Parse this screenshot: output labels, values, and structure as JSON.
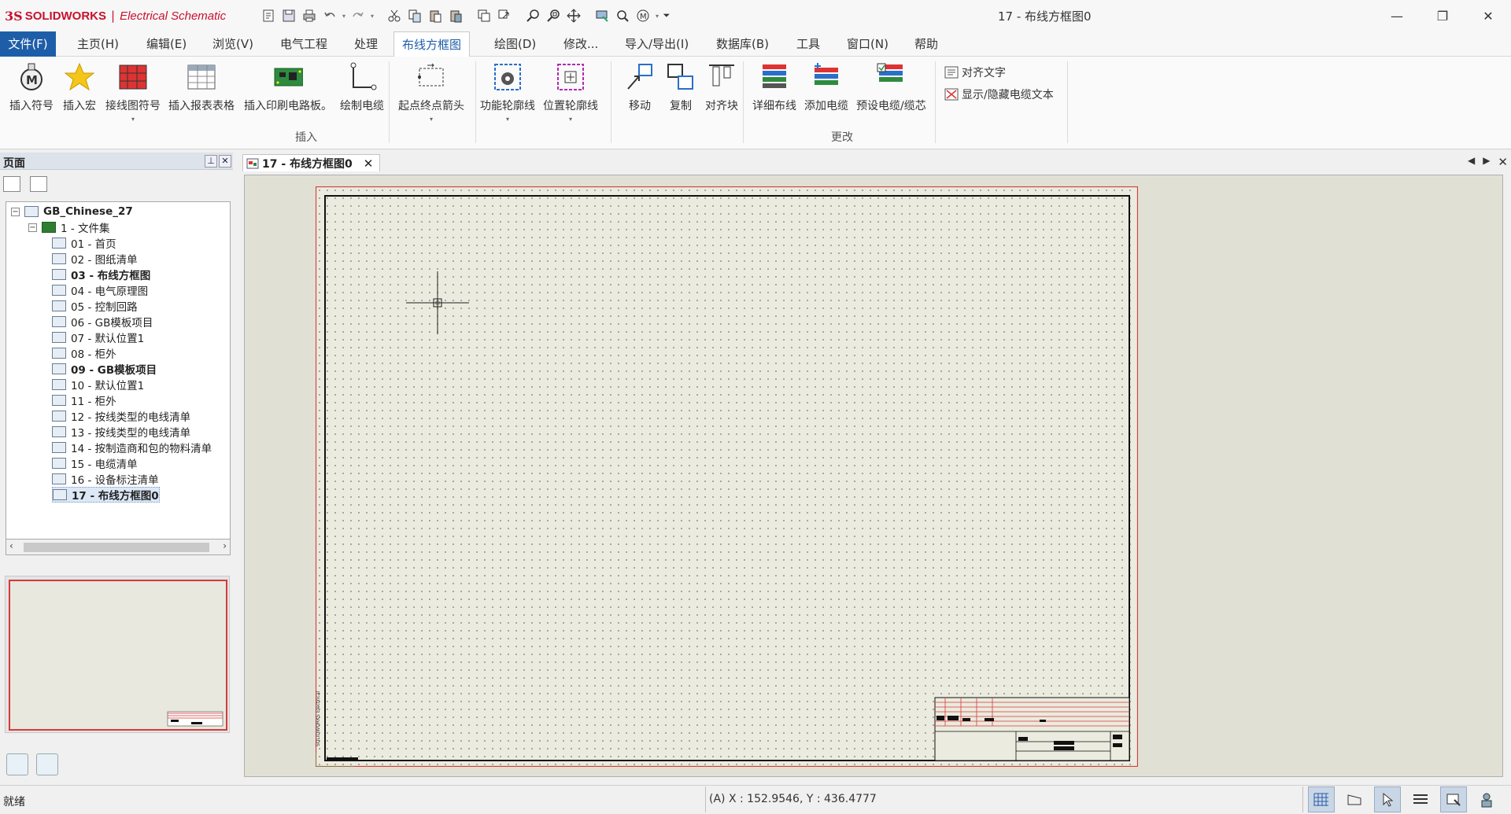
{
  "app": {
    "brand_ds": "3S",
    "brand_name": "SOLIDWORKS",
    "brand_sep": "|",
    "brand_product": "Electrical Schematic",
    "document_title": "17 - 布线方框图0"
  },
  "menu": {
    "tabs": [
      "文件(F)",
      "主页(H)",
      "编辑(E)",
      "浏览(V)",
      "电气工程",
      "处理",
      "布线方框图",
      "绘图(D)",
      "修改...",
      "导入/导出(I)",
      "数据库(B)",
      "工具",
      "窗口(N)",
      "帮助"
    ],
    "active_tab": "布线方框图"
  },
  "ribbon": {
    "insert_buttons": [
      "插入符号",
      "插入宏",
      "接线图符号",
      "插入报表表格",
      "插入印刷电路板。",
      "绘制电缆",
      "起点终点箭头",
      "功能轮廓线",
      "位置轮廓线"
    ],
    "modify_buttons": [
      "移动",
      "复制",
      "对齐块",
      "详细布线",
      "添加电缆",
      "预设电缆/缆芯"
    ],
    "small_buttons": [
      "对齐文字",
      "显示/隐藏电缆文本"
    ],
    "group_insert": "插入",
    "group_modify": "更改"
  },
  "left_panel": {
    "title": "页面",
    "tree_root": "GB_Chinese_27",
    "tree_folder": "1 - 文件集",
    "tree_items": [
      {
        "label": "01 - 首页",
        "selected": false,
        "bold": false
      },
      {
        "label": "02 - 图纸清单",
        "selected": false,
        "bold": false
      },
      {
        "label": "03 - 布线方框图",
        "selected": false,
        "bold": true
      },
      {
        "label": "04 - 电气原理图",
        "selected": false,
        "bold": false
      },
      {
        "label": "05 - 控制回路",
        "selected": false,
        "bold": false
      },
      {
        "label": "06 - GB模板项目",
        "selected": false,
        "bold": false
      },
      {
        "label": "07 - 默认位置1",
        "selected": false,
        "bold": false
      },
      {
        "label": "08 - 柜外",
        "selected": false,
        "bold": false
      },
      {
        "label": "09 - GB模板项目",
        "selected": false,
        "bold": true
      },
      {
        "label": "10 - 默认位置1",
        "selected": false,
        "bold": false
      },
      {
        "label": "11 - 柜外",
        "selected": false,
        "bold": false
      },
      {
        "label": "12 - 按线类型的电线清单",
        "selected": false,
        "bold": false
      },
      {
        "label": "13 - 按线类型的电线清单",
        "selected": false,
        "bold": false
      },
      {
        "label": "14 - 按制造商和包的物料清单",
        "selected": false,
        "bold": false
      },
      {
        "label": "15 - 电缆清单",
        "selected": false,
        "bold": false
      },
      {
        "label": "16 - 设备标注清单",
        "selected": false,
        "bold": false
      },
      {
        "label": "17 - 布线方框图0",
        "selected": true,
        "bold": true
      }
    ]
  },
  "document_tab": {
    "label": "17 - 布线方框图0",
    "close": "✕"
  },
  "sheet_vertical_text": "SOLIDWORKS Electrical",
  "status": {
    "text": "就绪",
    "coordinates": "(A) X : 152.9546, Y : 436.4777"
  },
  "colors": {
    "file_tab": "#1e5ea8",
    "sheet_border": "#d63a3a",
    "sheet_bg": "#ebebdf"
  }
}
